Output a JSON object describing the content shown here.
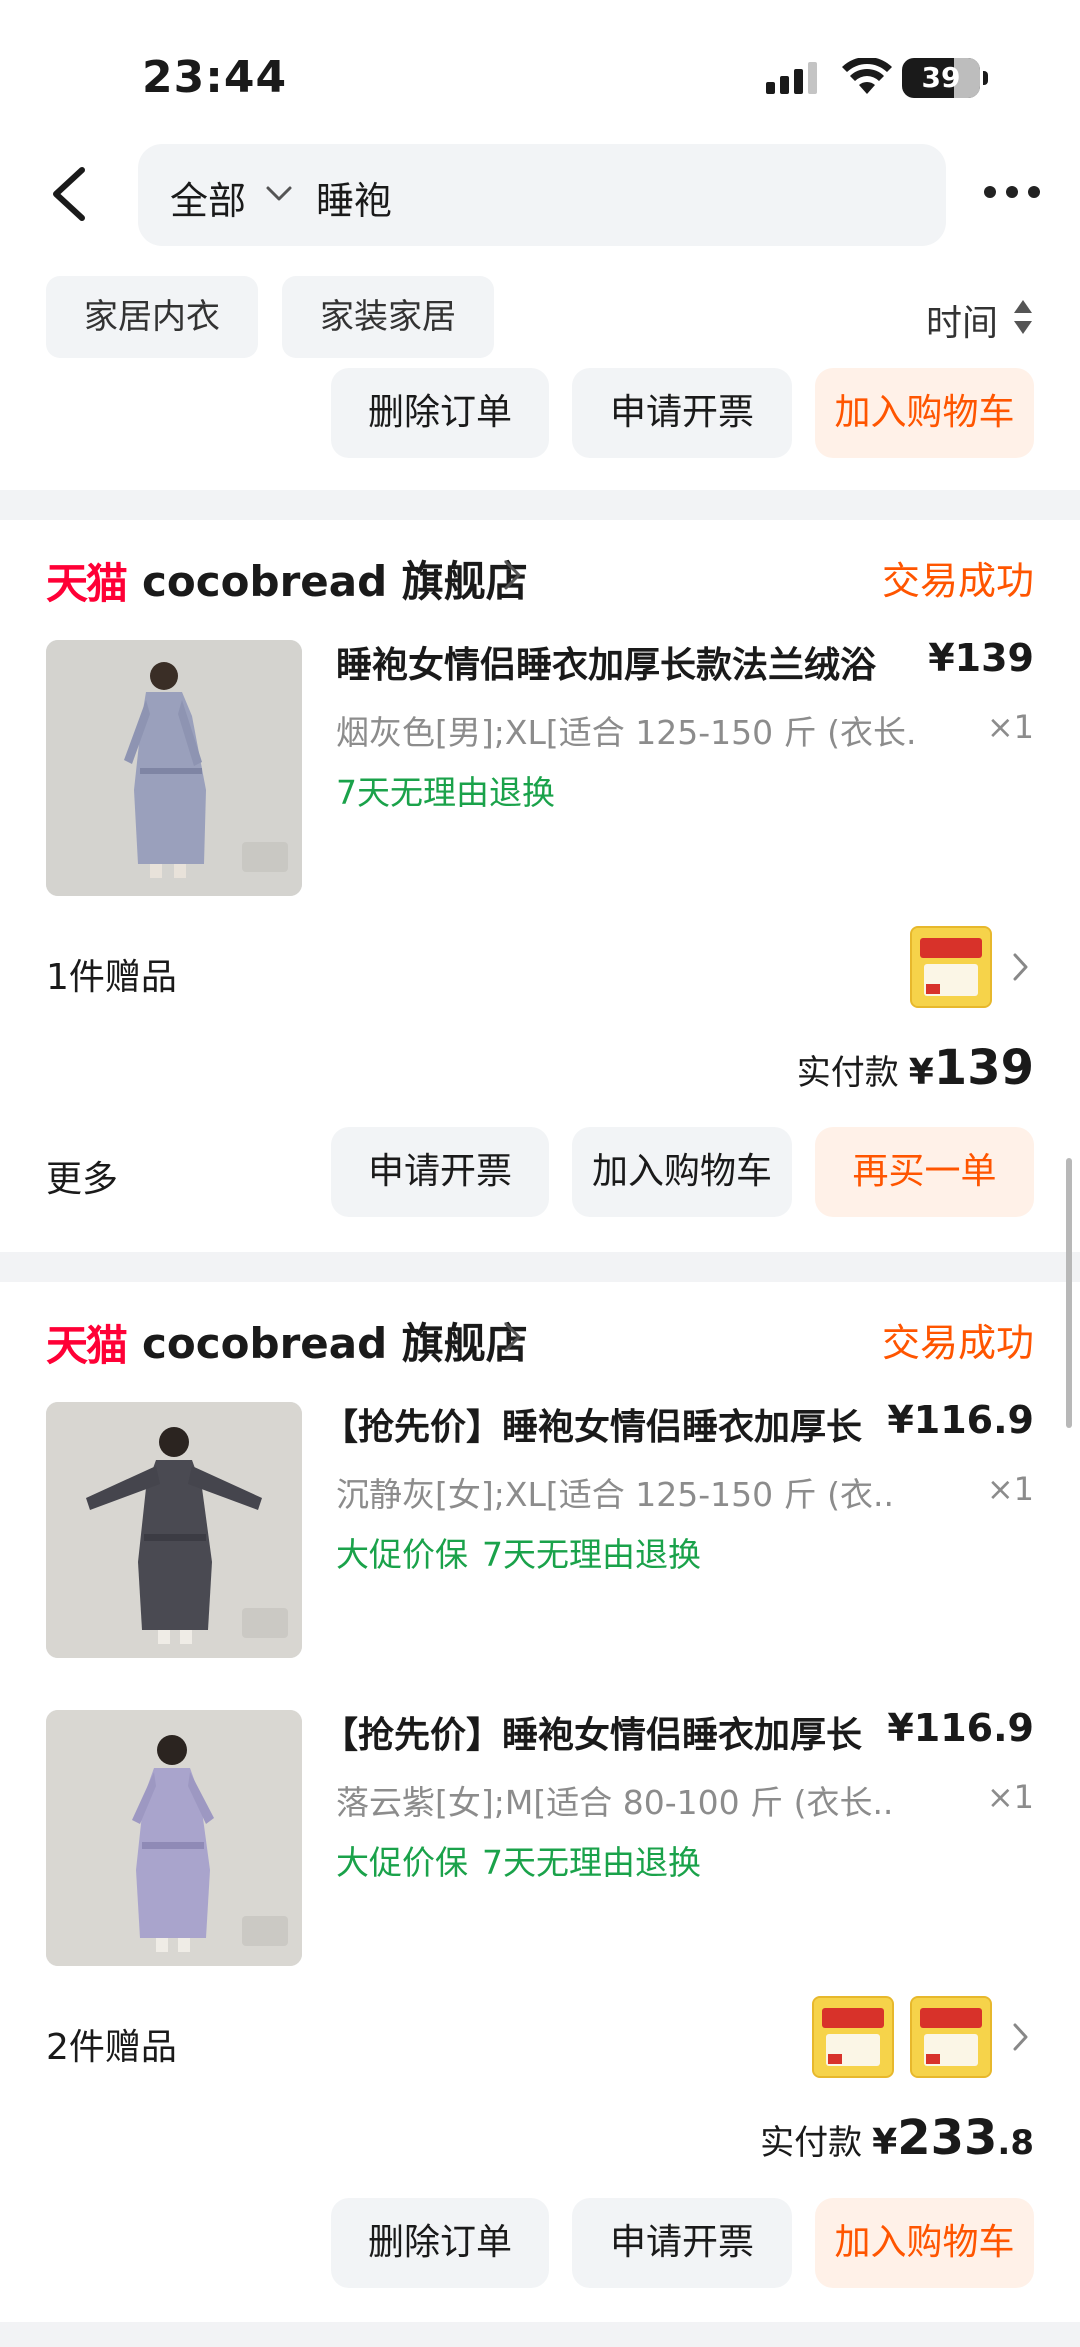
{
  "status_bar": {
    "time": "23:44",
    "battery": "39"
  },
  "search": {
    "scope": "全部",
    "term": "睡袍"
  },
  "filters": {
    "chips": [
      "家居内衣",
      "家装家居"
    ],
    "sort_label": "时间"
  },
  "top_order_actions": [
    "删除订单",
    "申请开票",
    "加入购物车"
  ],
  "orders": [
    {
      "platform": "天猫",
      "store": "cocobread 旗舰店",
      "status": "交易成功",
      "items": [
        {
          "title": "睡袍女情侣睡衣加厚长款法兰绒浴",
          "price": "¥139",
          "sku": "烟灰色[男];XL[适合 125-150 斤 (衣长...",
          "qty": "×1",
          "tags": [
            "7天无理由退换"
          ]
        }
      ],
      "gifts_label": "1件赠品",
      "paid": {
        "label": "实付款",
        "currency": "¥",
        "integer": "139",
        "decimal": ""
      },
      "more": "更多",
      "actions": [
        "申请开票",
        "加入购物车",
        "再买一单"
      ]
    },
    {
      "platform": "天猫",
      "store": "cocobread 旗舰店",
      "status": "交易成功",
      "items": [
        {
          "title": "【抢先价】睡袍女情侣睡衣加厚长",
          "price": "¥116.9",
          "sku": "沉静灰[女];XL[适合 125-150 斤 (衣...",
          "qty": "×1",
          "tags": [
            "大促价保",
            "7天无理由退换"
          ]
        },
        {
          "title": "【抢先价】睡袍女情侣睡衣加厚长",
          "price": "¥116.9",
          "sku": "落云紫[女];M[适合 80-100 斤 (衣长...",
          "qty": "×1",
          "tags": [
            "大促价保",
            "7天无理由退换"
          ]
        }
      ],
      "gifts_label": "2件赠品",
      "paid": {
        "label": "实付款",
        "currency": "¥",
        "integer": "233",
        "decimal": ".8"
      },
      "actions": [
        "删除订单",
        "申请开票",
        "加入购物车"
      ]
    }
  ],
  "colors": {
    "accent": "#ff5500",
    "tmall": "#ff0036",
    "green_tag": "#1aa24a",
    "chip_bg": "#f2f4f6"
  }
}
